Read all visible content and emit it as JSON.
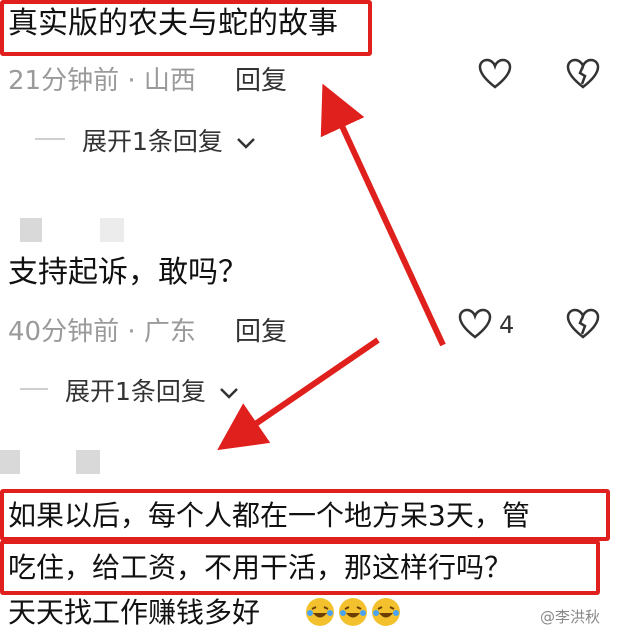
{
  "comment1": {
    "text": "真实版的农夫与蛇的故事",
    "time": "21分钟前",
    "sep": "·",
    "location": "山西",
    "reply": "回复",
    "expand": "展开1条回复"
  },
  "comment2": {
    "text": "支持起诉，敢吗？",
    "time": "40分钟前",
    "sep": "·",
    "location": "广东",
    "reply": "回复",
    "like_count": "4",
    "expand": "展开1条回复"
  },
  "comment3": {
    "line1": "如果以后，每个人都在一个地方呆3天，管",
    "line2": "吃住，给工资，不用干活，那这样行吗？",
    "line3": "天天找工作赚钱多好"
  },
  "watermark": "@李洪秋",
  "colors": {
    "highlight": "#e0201c",
    "meta": "#9a9a9a"
  },
  "icons": [
    "heart-outline-icon",
    "broken-heart-icon",
    "chevron-down-icon",
    "laughing-emoji-icon",
    "arrow-annotation"
  ]
}
